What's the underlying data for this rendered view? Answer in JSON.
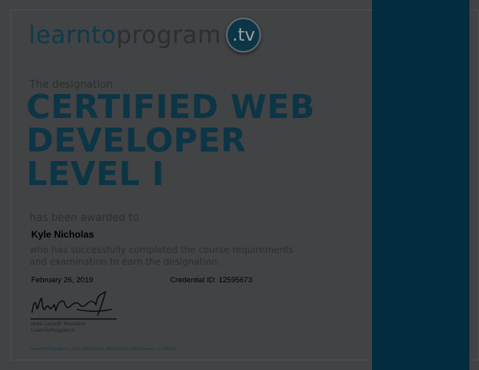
{
  "logo": {
    "part1": "learnto",
    "part2": "program",
    "badge": ".tv"
  },
  "certificate": {
    "designation_label": "The designation",
    "title_lines": [
      "CERTIFIED WEB",
      "DEVELOPER",
      "LEVEL I"
    ],
    "awarded_label": "has been awarded to",
    "recipient": "Kyle Nicholas",
    "completed_text": "who has successfully completed the course requirements and examination to earn the designation.",
    "date": "February 26, 2019",
    "credential": "Credential ID: 12595673",
    "signer_name": "Mark Lassoff, President",
    "signer_org": "LearnToProgram.tv",
    "footer": "LearnToProgram.tv, LLC | 129 Church Street #230 | New Haven, CT 06510"
  },
  "colors": {
    "brand": "#0c3546",
    "side_panel": "#042c3f",
    "background": "#424344"
  }
}
